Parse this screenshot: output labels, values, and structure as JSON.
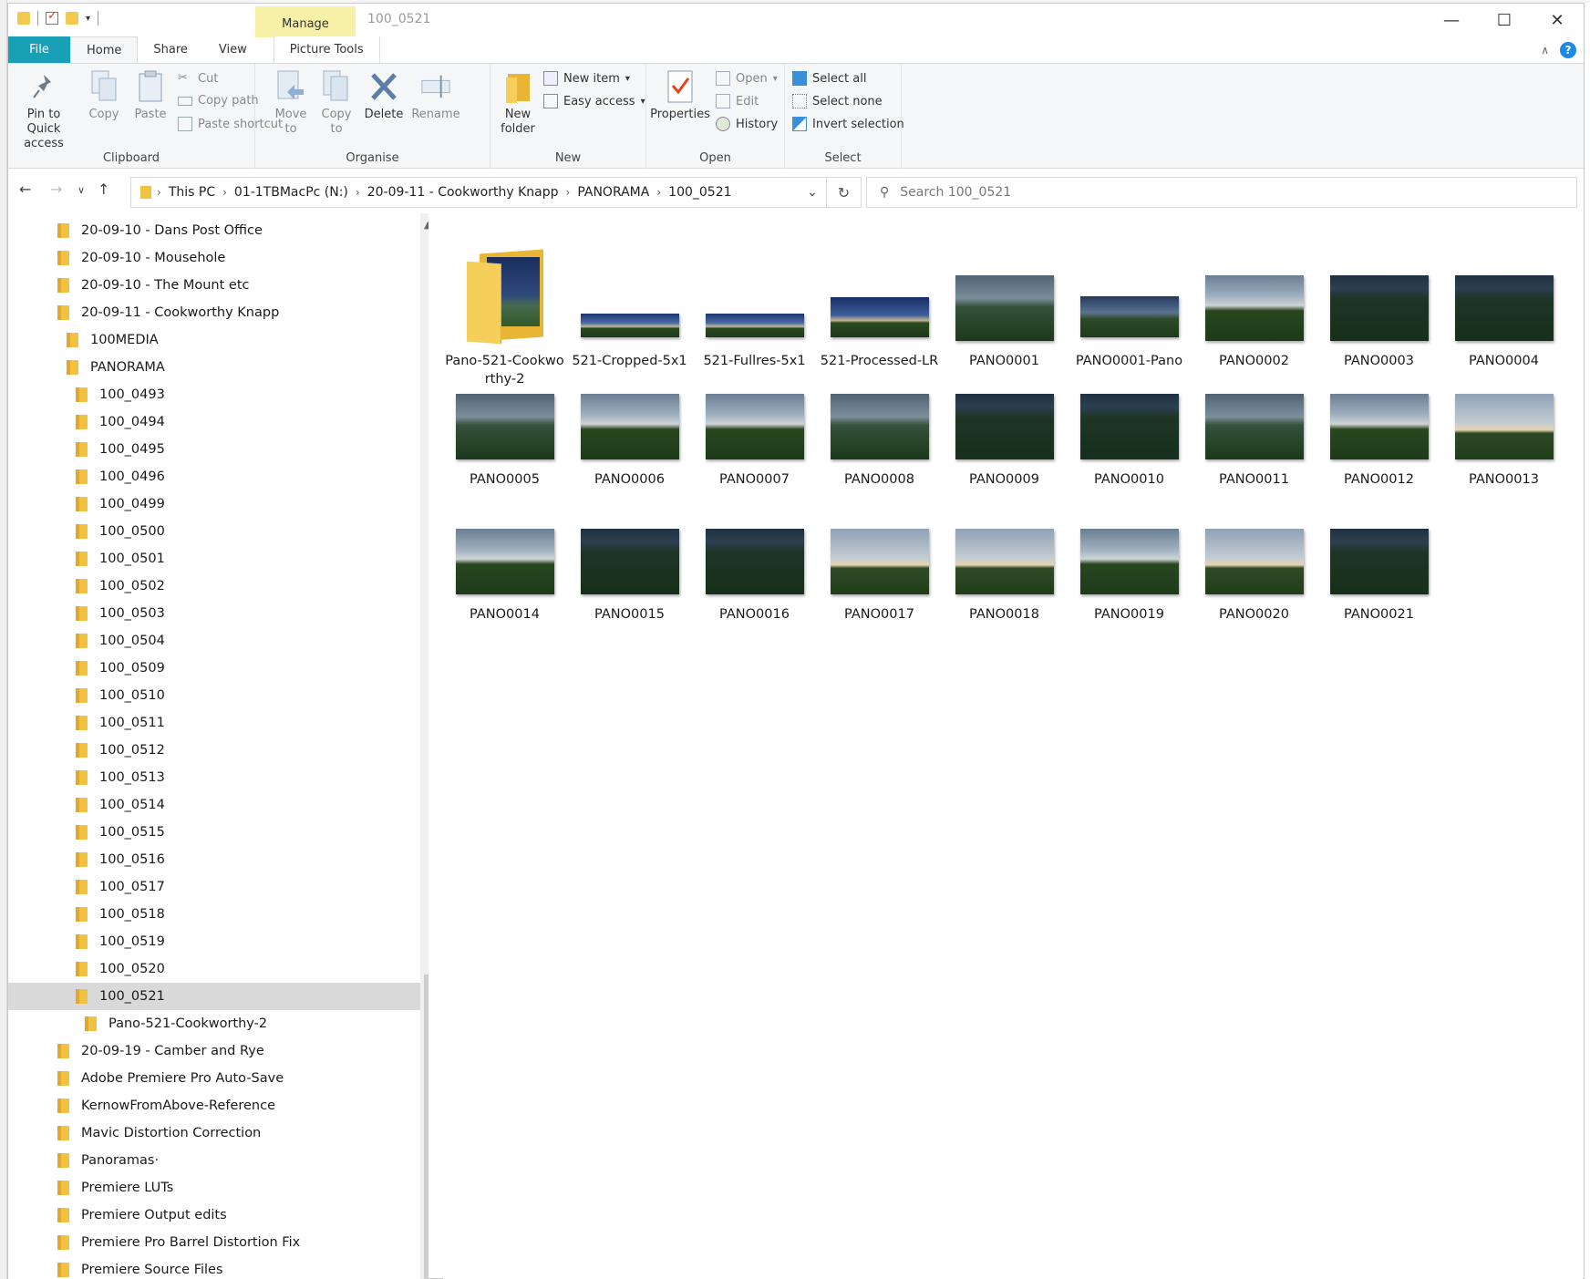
{
  "window": {
    "title": "100_0521",
    "contextual_tab": "Manage",
    "minimize": "—",
    "maximize": "☐",
    "close": "✕"
  },
  "ribbon": {
    "tabs": [
      "File",
      "Home",
      "Share",
      "View",
      "Picture Tools"
    ],
    "active_tab": "Home",
    "clipboard": {
      "label": "Clipboard",
      "pin_to_quick_access": "Pin to Quick access",
      "copy": "Copy",
      "paste": "Paste",
      "cut": "Cut",
      "copy_path": "Copy path",
      "paste_shortcut": "Paste shortcut"
    },
    "organise": {
      "label": "Organise",
      "move_to": "Move to",
      "copy_to": "Copy to",
      "delete": "Delete",
      "rename": "Rename"
    },
    "new": {
      "label": "New",
      "new_folder": "New folder",
      "new_item": "New item",
      "easy_access": "Easy access"
    },
    "open": {
      "label": "Open",
      "properties": "Properties",
      "open": "Open",
      "edit": "Edit",
      "history": "History"
    },
    "select": {
      "label": "Select",
      "select_all": "Select all",
      "select_none": "Select none",
      "invert_selection": "Invert selection"
    }
  },
  "address": {
    "crumbs": [
      "This PC",
      "01-1TBMacPc (N:)",
      "20-09-11 - Cookworthy Knapp",
      "PANORAMA",
      "100_0521"
    ]
  },
  "search": {
    "placeholder": "Search 100_0521"
  },
  "nav_tree": [
    {
      "label": "20-09-10 - Dans Post Office",
      "level": 0
    },
    {
      "label": "20-09-10 - Mousehole",
      "level": 0
    },
    {
      "label": "20-09-10 - The Mount etc",
      "level": 0
    },
    {
      "label": "20-09-11 - Cookworthy Knapp",
      "level": 0
    },
    {
      "label": "100MEDIA",
      "level": 1
    },
    {
      "label": "PANORAMA",
      "level": 1
    },
    {
      "label": "100_0493",
      "level": 2
    },
    {
      "label": "100_0494",
      "level": 2
    },
    {
      "label": "100_0495",
      "level": 2
    },
    {
      "label": "100_0496",
      "level": 2
    },
    {
      "label": "100_0499",
      "level": 2
    },
    {
      "label": "100_0500",
      "level": 2
    },
    {
      "label": "100_0501",
      "level": 2
    },
    {
      "label": "100_0502",
      "level": 2
    },
    {
      "label": "100_0503",
      "level": 2
    },
    {
      "label": "100_0504",
      "level": 2
    },
    {
      "label": "100_0509",
      "level": 2
    },
    {
      "label": "100_0510",
      "level": 2
    },
    {
      "label": "100_0511",
      "level": 2
    },
    {
      "label": "100_0512",
      "level": 2
    },
    {
      "label": "100_0513",
      "level": 2
    },
    {
      "label": "100_0514",
      "level": 2
    },
    {
      "label": "100_0515",
      "level": 2
    },
    {
      "label": "100_0516",
      "level": 2
    },
    {
      "label": "100_0517",
      "level": 2
    },
    {
      "label": "100_0518",
      "level": 2
    },
    {
      "label": "100_0519",
      "level": 2
    },
    {
      "label": "100_0520",
      "level": 2
    },
    {
      "label": "100_0521",
      "level": 2,
      "selected": true
    },
    {
      "label": "Pano-521-Cookworthy-2",
      "level": 3
    },
    {
      "label": "20-09-19 - Camber and Rye",
      "level": 0
    },
    {
      "label": "Adobe Premiere Pro Auto-Save",
      "level": 0
    },
    {
      "label": "KernowFromAbove-Reference",
      "level": 0
    },
    {
      "label": "Mavic Distortion Correction",
      "level": 0
    },
    {
      "label": "Panoramas·",
      "level": 0
    },
    {
      "label": "Premiere LUTs",
      "level": 0
    },
    {
      "label": "Premiere Output edits",
      "level": 0
    },
    {
      "label": "Premiere Pro Barrel Distortion Fix",
      "level": 0
    },
    {
      "label": "Premiere Source Files",
      "level": 0
    }
  ],
  "files": [
    {
      "name": "Pano-521-Cookworthy-2",
      "kind": "folder"
    },
    {
      "name": "521-Cropped-5x1",
      "kind": "pano"
    },
    {
      "name": "521-Fullres-5x1",
      "kind": "pano"
    },
    {
      "name": "521-Processed-LR",
      "kind": "panobig"
    },
    {
      "name": "PANO0001",
      "kind": "mid"
    },
    {
      "name": "PANO0001-Pano",
      "kind": "widepano"
    },
    {
      "name": "PANO0002",
      "kind": "sky"
    },
    {
      "name": "PANO0003",
      "kind": "dusk"
    },
    {
      "name": "PANO0004",
      "kind": "dusk"
    },
    {
      "name": "PANO0005",
      "kind": "mid"
    },
    {
      "name": "PANO0006",
      "kind": "sky"
    },
    {
      "name": "PANO0007",
      "kind": "sky"
    },
    {
      "name": "PANO0008",
      "kind": "mid"
    },
    {
      "name": "PANO0009",
      "kind": "dusk"
    },
    {
      "name": "PANO0010",
      "kind": "dusk"
    },
    {
      "name": "PANO0011",
      "kind": "mid"
    },
    {
      "name": "PANO0012",
      "kind": "sky"
    },
    {
      "name": "PANO0013",
      "kind": "bright"
    },
    {
      "name": "PANO0014",
      "kind": "sky"
    },
    {
      "name": "PANO0015",
      "kind": "dusk"
    },
    {
      "name": "PANO0016",
      "kind": "dusk"
    },
    {
      "name": "PANO0017",
      "kind": "bright"
    },
    {
      "name": "PANO0018",
      "kind": "bright"
    },
    {
      "name": "PANO0019",
      "kind": "sky"
    },
    {
      "name": "PANO0020",
      "kind": "bright"
    },
    {
      "name": "PANO0021",
      "kind": "dusk"
    }
  ],
  "colors": {
    "file_tab": "#19a0b6",
    "manage_tab": "#f7f1a8",
    "folder": "#f3c141",
    "selection": "#d9d9d9"
  }
}
